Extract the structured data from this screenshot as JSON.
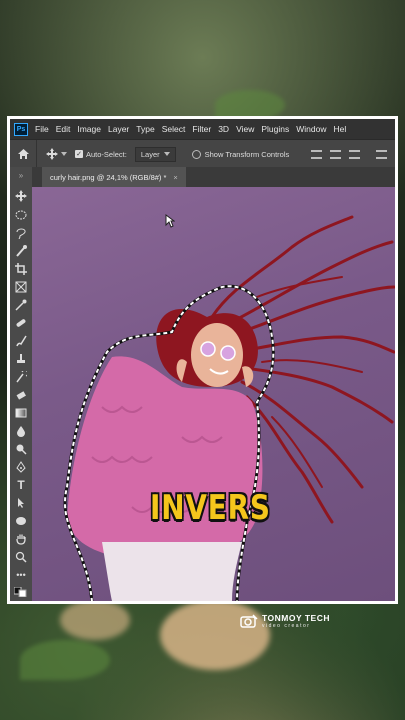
{
  "app": {
    "logo": "Ps"
  },
  "menu": [
    "File",
    "Edit",
    "Image",
    "Layer",
    "Type",
    "Select",
    "Filter",
    "3D",
    "View",
    "Plugins",
    "Window",
    "Hel"
  ],
  "options_bar": {
    "auto_select_label": "Auto-Select:",
    "auto_select_value": "Layer",
    "transform_label": "Show Transform Controls"
  },
  "document": {
    "tab_title": "curly hair.png @ 24,1% (RGB/8#) *",
    "close_glyph": "×"
  },
  "caption": "INVERS",
  "watermark": {
    "title": "TONMOY TECH",
    "subtitle": "video creator"
  },
  "colors": {
    "canvas": "#7a5a89",
    "caption": "#f4c61c",
    "sweater": "#d46aa8",
    "hair": "#8e1620"
  }
}
